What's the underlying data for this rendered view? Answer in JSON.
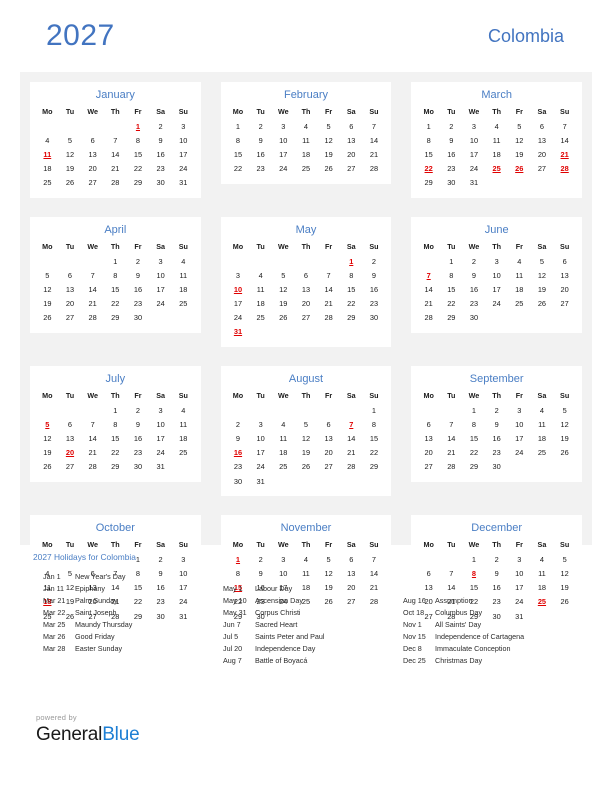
{
  "header": {
    "year": "2027",
    "country": "Colombia"
  },
  "weekday_headers": [
    "Mo",
    "Tu",
    "We",
    "Th",
    "Fr",
    "Sa",
    "Su"
  ],
  "months": [
    {
      "name": "January",
      "lead_blanks": 4,
      "days": 31,
      "holidays": [
        1,
        11
      ]
    },
    {
      "name": "February",
      "lead_blanks": 0,
      "days": 28,
      "holidays": []
    },
    {
      "name": "March",
      "lead_blanks": 0,
      "days": 31,
      "holidays": [
        21,
        22,
        25,
        26,
        28
      ]
    },
    {
      "name": "April",
      "lead_blanks": 3,
      "days": 30,
      "holidays": []
    },
    {
      "name": "May",
      "lead_blanks": 5,
      "days": 31,
      "holidays": [
        1,
        10,
        31
      ]
    },
    {
      "name": "June",
      "lead_blanks": 1,
      "days": 30,
      "holidays": [
        7
      ]
    },
    {
      "name": "July",
      "lead_blanks": 3,
      "days": 31,
      "holidays": [
        5,
        20
      ]
    },
    {
      "name": "August",
      "lead_blanks": 6,
      "days": 31,
      "holidays": [
        7,
        16
      ]
    },
    {
      "name": "September",
      "lead_blanks": 2,
      "days": 30,
      "holidays": []
    },
    {
      "name": "October",
      "lead_blanks": 4,
      "days": 31,
      "holidays": [
        18
      ]
    },
    {
      "name": "November",
      "lead_blanks": 0,
      "days": 30,
      "holidays": [
        1,
        15
      ]
    },
    {
      "name": "December",
      "lead_blanks": 2,
      "days": 31,
      "holidays": [
        8,
        25
      ]
    }
  ],
  "holidays_section": {
    "heading": "2027 Holidays for Colombia",
    "columns": [
      [
        {
          "date": "Jan 1",
          "name": "New Year's Day"
        },
        {
          "date": "Jan 11",
          "name": "Epiphany"
        },
        {
          "date": "Mar 21",
          "name": "Palm Sunday"
        },
        {
          "date": "Mar 22",
          "name": "Saint Joseph"
        },
        {
          "date": "Mar 25",
          "name": "Maundy Thursday"
        },
        {
          "date": "Mar 26",
          "name": "Good Friday"
        },
        {
          "date": "Mar 28",
          "name": "Easter Sunday"
        }
      ],
      [
        {
          "date": "May 1",
          "name": "Labour Day"
        },
        {
          "date": "May 10",
          "name": "Ascension Day"
        },
        {
          "date": "May 31",
          "name": "Corpus Christi"
        },
        {
          "date": "Jun 7",
          "name": "Sacred Heart"
        },
        {
          "date": "Jul 5",
          "name": "Saints Peter and Paul"
        },
        {
          "date": "Jul 20",
          "name": "Independence Day"
        },
        {
          "date": "Aug 7",
          "name": "Battle of Boyacá"
        }
      ],
      [
        {
          "date": "Aug 16",
          "name": "Assumption"
        },
        {
          "date": "Oct 18",
          "name": "Columbus Day"
        },
        {
          "date": "Nov 1",
          "name": "All Saints' Day"
        },
        {
          "date": "Nov 15",
          "name": "Independence of Cartagena"
        },
        {
          "date": "Dec 8",
          "name": "Immaculate Conception"
        },
        {
          "date": "Dec 25",
          "name": "Christmas Day"
        }
      ]
    ]
  },
  "footer": {
    "powered_by": "powered by",
    "logo_part_1": "General",
    "logo_part_2": "Blue"
  },
  "colors": {
    "accent_blue": "#4274c0",
    "month_blue": "#4a7ec4",
    "holiday_red": "#e00000",
    "band_grey": "#f2f2f2",
    "logo_blue": "#1e7fd4",
    "text": "#1a1a1a"
  }
}
